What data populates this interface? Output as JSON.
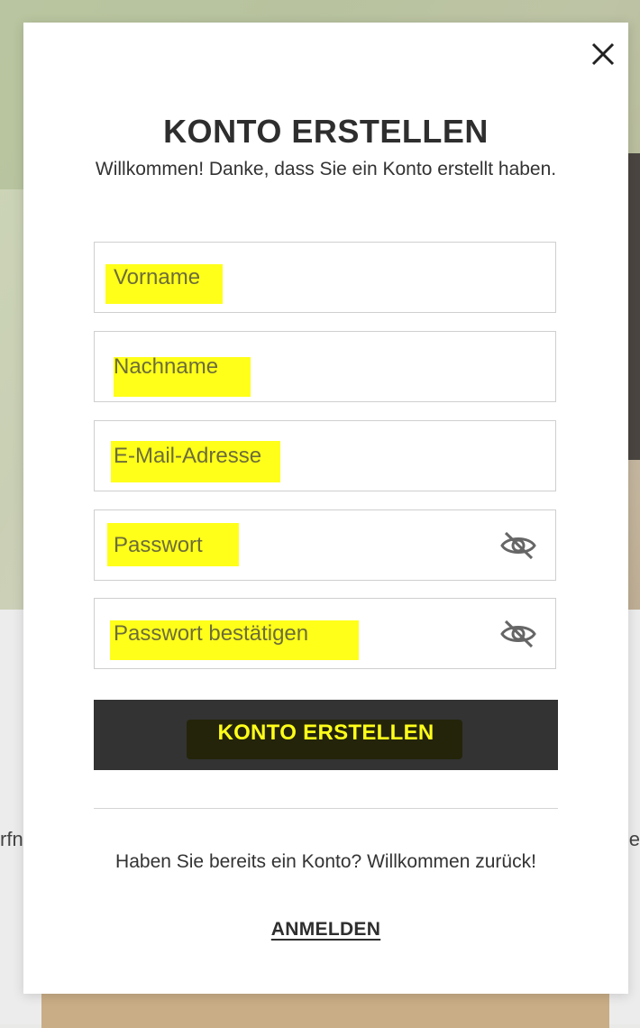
{
  "background": {
    "left_edge_text": "rfn",
    "right_edge_text": "e"
  },
  "modal": {
    "close_icon": "close-icon",
    "title": "KONTO ERSTELLEN",
    "subtitle": "Willkommen! Danke, dass Sie ein Konto erstellt haben.",
    "fields": {
      "first_name": {
        "placeholder": "Vorname",
        "value": ""
      },
      "last_name": {
        "placeholder": "Nachname",
        "value": ""
      },
      "email": {
        "placeholder": "E-Mail-Adresse",
        "value": ""
      },
      "password": {
        "placeholder": "Passwort",
        "value": "",
        "toggle_icon": "eye-slash-icon"
      },
      "password_confirm": {
        "placeholder": "Passwort bestätigen",
        "value": "",
        "toggle_icon": "eye-slash-icon"
      }
    },
    "submit_label": "KONTO ERSTELLEN",
    "have_account_text": "Haben Sie bereits ein Konto? Willkommen zurück!",
    "login_label": "ANMELDEN"
  },
  "colors": {
    "highlight": "#ffff1a",
    "button_bg": "#333333",
    "text": "#2e2e2e"
  }
}
